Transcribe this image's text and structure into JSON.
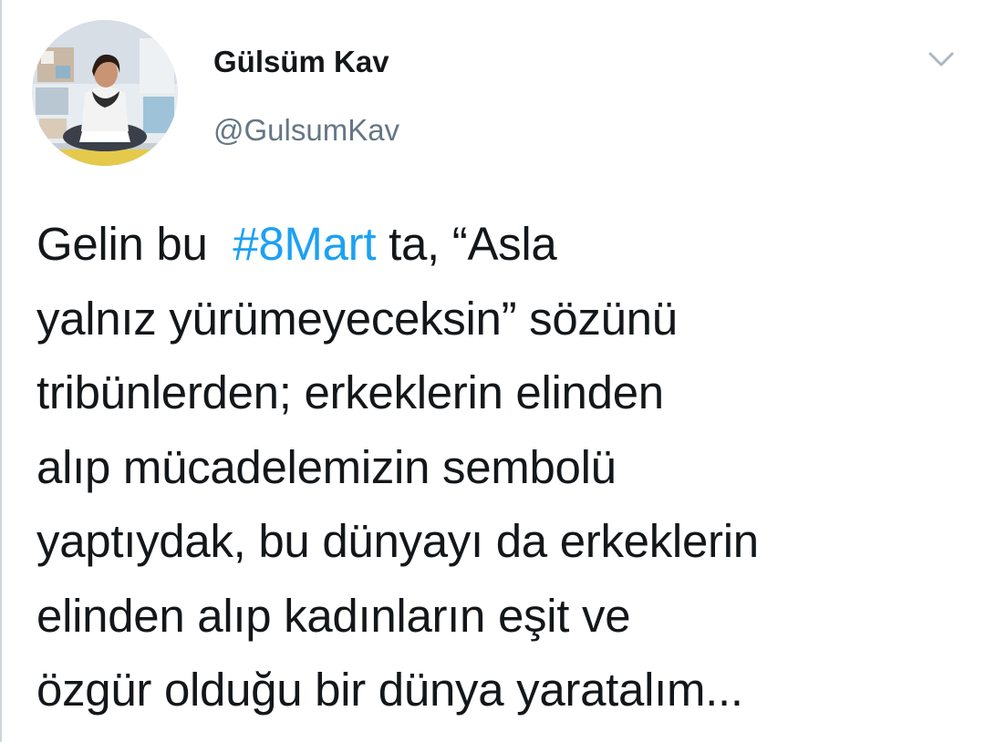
{
  "tweet": {
    "author": {
      "name": "Gülsüm Kav",
      "handle": "@GulsumKav"
    },
    "menu_icon": "chevron-down-icon",
    "text_lines": [
      {
        "before": "Gelin bu  ",
        "hashtag": "#8Mart",
        "after": " ta, “Asla"
      },
      {
        "text": "yalnız yürümeyeceksin” sözünü"
      },
      {
        "text": "tribünlerden; erkeklerin elinden"
      },
      {
        "text": "alıp mücadelemizin sembolü"
      },
      {
        "text": "yaptıydak, bu dünyayı da erkeklerin"
      },
      {
        "text": "elinden alıp kadınların eşit ve"
      },
      {
        "text": "özgür olduğu bir dünya yaratalım..."
      }
    ]
  },
  "colors": {
    "text": "#14171a",
    "secondary": "#657786",
    "hashtag": "#1da1f2",
    "caret": "#aab8c2"
  }
}
